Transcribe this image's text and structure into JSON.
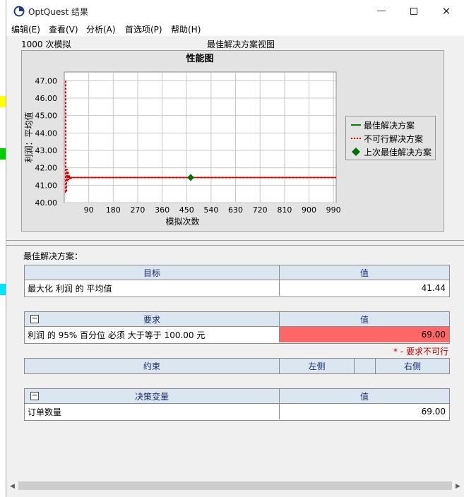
{
  "window": {
    "title": "OptQuest 结果"
  },
  "menu": [
    "编辑(E)",
    "查看(V)",
    "分析(A)",
    "首选项(P)",
    "帮助(H)"
  ],
  "header": {
    "simulations": "1000 次模拟",
    "view_title": "最佳解决方案视图"
  },
  "chart_data": {
    "type": "line",
    "title": "性能图",
    "xlabel": "模拟次数",
    "ylabel": "利润：平均值",
    "xlim": [
      0,
      1000
    ],
    "ylim": [
      40.0,
      47.5
    ],
    "x_ticks": [
      90,
      180,
      270,
      360,
      450,
      540,
      630,
      720,
      810,
      900,
      990
    ],
    "y_ticks": [
      "40.00",
      "41.00",
      "42.00",
      "43.00",
      "44.00",
      "45.00",
      "46.00",
      "47.00"
    ],
    "grid": true,
    "legend_position": "right",
    "series": [
      {
        "name": "最佳解决方案",
        "color": "#008000",
        "style": "solid",
        "x": [
          10,
          1000
        ],
        "y": [
          41.44,
          41.44
        ]
      },
      {
        "name": "不可行解决方案",
        "color": "#e00000",
        "style": "dashed",
        "x": [
          5,
          5,
          8,
          8,
          11,
          12,
          14,
          16,
          18,
          20,
          22,
          25,
          30,
          1000
        ],
        "y": [
          47.0,
          40.6,
          40.6,
          41.9,
          41.9,
          41.2,
          41.8,
          41.3,
          41.6,
          41.35,
          41.5,
          41.4,
          41.44,
          41.44
        ]
      },
      {
        "name": "上次最佳解决方案",
        "color": "#007000",
        "style": "marker",
        "x": [
          465
        ],
        "y": [
          41.44
        ]
      }
    ]
  },
  "best_label": "最佳解决方案：",
  "objective": {
    "col1": "目标",
    "col2": "值",
    "row_label": "最大化 利润 的 平均值",
    "row_value": "41.44"
  },
  "requirement": {
    "col1": "要求",
    "col2": "值",
    "row_label": "利润 的 95% 百分位 必须 大于等于 100.00 元",
    "row_value": "69.00",
    "highlight": "#ff6666"
  },
  "infeasible_note": "* - 要求不可行",
  "constraint": {
    "col1": "约束",
    "col2": "左侧",
    "col3": "右侧"
  },
  "decision": {
    "col1": "决策变量",
    "col2": "值",
    "row_label": "订单数量",
    "row_value": "69.00"
  },
  "icons": {
    "collapse": "minus-box-icon",
    "minimize": "minimize-icon",
    "maximize": "maximize-icon",
    "close": "close-icon"
  }
}
